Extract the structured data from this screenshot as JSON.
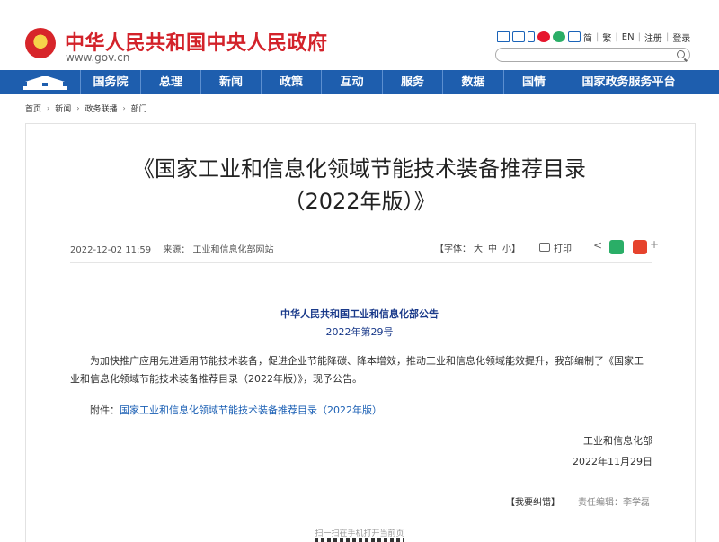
{
  "header": {
    "site_title": "中华人民共和国中央人民政府",
    "site_domain": "www.gov.cn",
    "links": [
      "简",
      "繁",
      "EN",
      "注册",
      "登录"
    ],
    "icons": [
      "mail-icon",
      "tv-icon",
      "phone-icon",
      "weibo-icon",
      "wechat-icon",
      "app-icon"
    ],
    "search_placeholder": ""
  },
  "nav": {
    "items": [
      "国务院",
      "总理",
      "新闻",
      "政策",
      "互动",
      "服务",
      "数据",
      "国情",
      "国家政务服务平台"
    ]
  },
  "breadcrumb": [
    "首页",
    "新闻",
    "政务联播",
    "部门"
  ],
  "article": {
    "title_line1": "《国家工业和信息化领域节能技术装备推荐目录",
    "title_line2": "（2022年版）》",
    "date": "2022-12-02 11:59",
    "source_label": "来源：",
    "source": "工业和信息化部网站",
    "font_size_label": "【字体：",
    "font_large": "大",
    "font_medium": "中",
    "font_small": "小】",
    "print_label": "打印",
    "issuer": "中华人民共和国工业和信息化部公告",
    "doc_number": "2022年第29号",
    "paragraph": "为加快推广应用先进适用节能技术装备，促进企业节能降碳、降本增效，推动工业和信息化领域能效提升，我部编制了《国家工业和信息化领域节能技术装备推荐目录（2022年版）》，现予公告。",
    "attachment_label": "附件：",
    "attachment_link": "国家工业和信息化领域节能技术装备推荐目录（2022年版）",
    "sign_org": "工业和信息化部",
    "sign_date": "2022年11月29日",
    "correction": "【我要纠错】",
    "editor": "责任编辑：李学磊",
    "scan_hint": "扫一扫在手机打开当前页"
  },
  "colors": {
    "brand_red": "#d3222a",
    "nav_blue": "#1e5eae",
    "link_blue": "#1a5fb4"
  }
}
